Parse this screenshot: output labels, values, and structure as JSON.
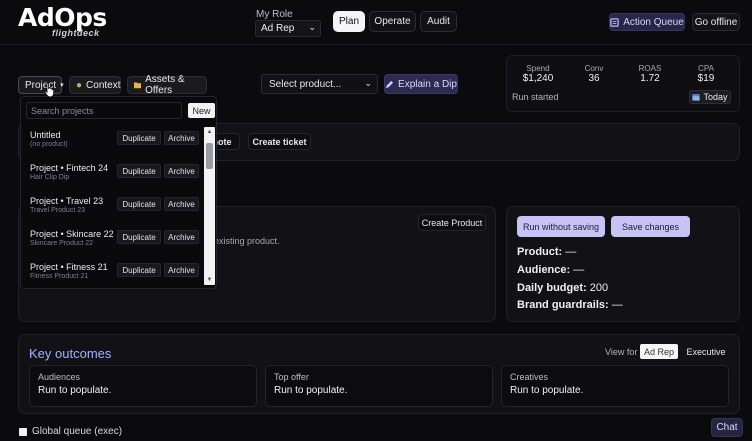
{
  "logo": {
    "main": "AdOps",
    "sub": "flightdeck"
  },
  "header": {
    "role_label": "My Role",
    "role_value": "Ad Rep",
    "modes": [
      "Plan",
      "Operate",
      "Audit"
    ],
    "active_mode": "Plan",
    "action_queue": "Action Queue",
    "go_offline": "Go offline"
  },
  "toolbar": {
    "project": "Project",
    "context": "Context",
    "assets": "Assets & Offers",
    "product_select": "Select product...",
    "explain_dip": "Explain a Dip"
  },
  "stats": {
    "items": [
      {
        "label": "Spend",
        "value": "$1,240"
      },
      {
        "label": "Conv",
        "value": "36"
      },
      {
        "label": "ROAS",
        "value": "1.72"
      },
      {
        "label": "CPA",
        "value": "$19"
      }
    ],
    "run_status": "Run started",
    "today": "Today"
  },
  "quick_actions": {
    "note": "note",
    "ticket": "Create ticket"
  },
  "main_panel": {
    "create_product": "Create Product",
    "existing_text": "existing product."
  },
  "side_panel": {
    "run_without_saving": "Run without saving",
    "save_changes": "Save changes",
    "product": {
      "label": "Product:",
      "value": "—"
    },
    "audience": {
      "label": "Audience:",
      "value": "—"
    },
    "daily_budget": {
      "label": "Daily budget:",
      "value": "200"
    },
    "brand_guardrails": {
      "label": "Brand guardrails:",
      "value": "—"
    }
  },
  "outcomes": {
    "title": "Key outcomes",
    "view_for": "View for",
    "view_options": [
      "Ad Rep",
      "Executive"
    ],
    "selected_view": "Ad Rep",
    "cards": [
      {
        "title": "Audiences",
        "text": "Run to populate."
      },
      {
        "title": "Top offer",
        "text": "Run to populate."
      },
      {
        "title": "Creatives",
        "text": "Run to populate."
      }
    ]
  },
  "footer": {
    "global_queue": "Global queue (exec)",
    "chat": "Chat"
  },
  "dropdown": {
    "search_placeholder": "Search projects",
    "new": "New",
    "duplicate": "Duplicate",
    "archive": "Archive",
    "items": [
      {
        "name": "Untitled",
        "sub": "(no product)"
      },
      {
        "name": "Project • Fintech 24",
        "sub": "Hair Clip Dip"
      },
      {
        "name": "Project • Travel 23",
        "sub": "Travel Product 23"
      },
      {
        "name": "Project • Skincare 22",
        "sub": "Skincare Product 22"
      },
      {
        "name": "Project • Fitness 21",
        "sub": "Fitness Product 21"
      }
    ]
  },
  "colors": {
    "background": "#0b0b0d",
    "accent_lavender": "#c9c3f5",
    "accent_purple": "#2e2a52",
    "outcomes_title": "#9fb4ff"
  },
  "icons": {
    "context": "context-icon",
    "assets": "folder-icon",
    "explain": "pencil-icon",
    "queue": "queue-icon",
    "today": "calendar-icon"
  }
}
